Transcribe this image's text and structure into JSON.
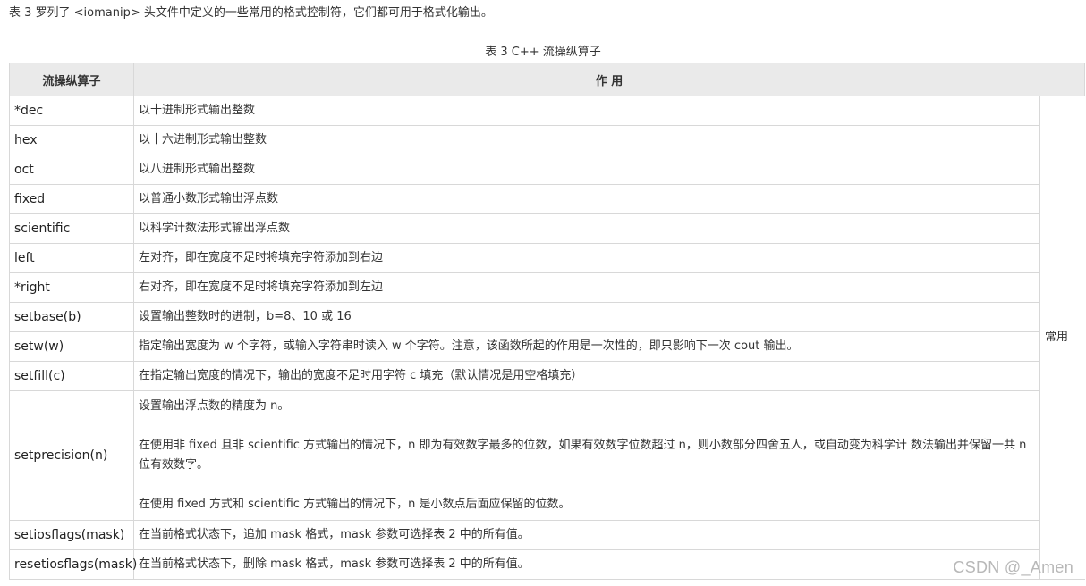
{
  "intro": "表 3 罗列了 <iomanip> 头文件中定义的一些常用的格式控制符，它们都可用于格式化输出。",
  "caption": "表 3 C++ 流操纵算子",
  "headers": {
    "name": "流操纵算子",
    "effect": "作  用"
  },
  "group_label": "常用",
  "rows": [
    {
      "name": "*dec",
      "desc": "以十进制形式输出整数"
    },
    {
      "name": "hex",
      "desc": "以十六进制形式输出整数"
    },
    {
      "name": "oct",
      "desc": "以八进制形式输出整数"
    },
    {
      "name": "fixed",
      "desc": "以普通小数形式输出浮点数"
    },
    {
      "name": "scientific",
      "desc": "以科学计数法形式输出浮点数"
    },
    {
      "name": "left",
      "desc": "左对齐，即在宽度不足时将填充字符添加到右边"
    },
    {
      "name": "*right",
      "desc": "右对齐，即在宽度不足时将填充字符添加到左边"
    },
    {
      "name": "setbase(b)",
      "desc": "设置输出整数时的进制，b=8、10 或 16"
    },
    {
      "name": "setw(w)",
      "desc": "指定输出宽度为 w 个字符，或输入字符串时读入 w 个字符。注意，该函数所起的作用是一次性的，即只影响下一次 cout 输出。"
    },
    {
      "name": "setfill(c)",
      "desc": "在指定输出宽度的情况下，输出的宽度不足时用字符 c 填充（默认情况是用空格填充）"
    },
    {
      "name": "setprecision(n)",
      "paragraphs": [
        "设置输出浮点数的精度为 n。",
        "在使用非 fixed 且非 scientific 方式输出的情况下，n 即为有效数字最多的位数，如果有效数字位数超过 n，则小数部分四舍五人，或自动变为科学计 数法输出并保留一共 n 位有效数字。",
        "在使用 fixed 方式和 scientific 方式输出的情况下，n 是小数点后面应保留的位数。"
      ]
    },
    {
      "name": "setiosflags(mask)",
      "desc": "在当前格式状态下，追加 mask 格式，mask 参数可选择表 2 中的所有值。"
    },
    {
      "name": "resetiosflags(mask)",
      "desc": "在当前格式状态下，删除 mask 格式，mask 参数可选择表 2 中的所有值。"
    }
  ],
  "watermark": "CSDN @_Amen"
}
